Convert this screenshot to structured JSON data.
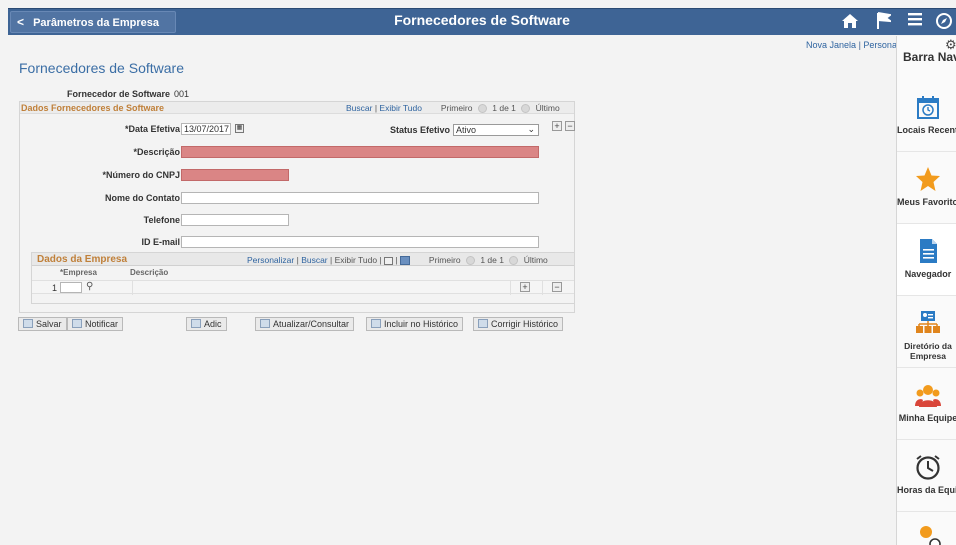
{
  "header": {
    "back_label": "Parâmetros da Empresa",
    "back_chevron": "<",
    "title": "Fornecedores de Software",
    "icons": [
      "home-icon",
      "flag-icon",
      "menu-icon",
      "compass-icon"
    ]
  },
  "links": {
    "new_window": "Nova Janela",
    "separator": "|",
    "personalize": "Personalizar"
  },
  "page_title": "Fornecedores de Software",
  "vendor": {
    "label": "Fornecedor de Software",
    "value": "001"
  },
  "group": {
    "title": "Dados Fornecedores de Software",
    "nav": {
      "find": "Buscar",
      "view_all": "Exibir Tudo",
      "first": "Primeiro",
      "counter": "1 de 1",
      "last": "Último"
    }
  },
  "fields": {
    "effdt_label": "*Data Efetiva",
    "effdt_value": "13/07/2017",
    "status_label": "Status Efetivo",
    "status_value": "Ativo",
    "descr_label": "*Descrição",
    "descr_value": "",
    "cnpj_label": "*Número do CNPJ",
    "cnpj_value": "",
    "contact_label": "Nome do Contato",
    "contact_value": "",
    "phone_label": "Telefone",
    "phone_value": "",
    "email_label": "ID E-mail",
    "email_value": ""
  },
  "subgrid": {
    "title": "Dados da Empresa",
    "nav": {
      "personalize": "Personalizar",
      "find": "Buscar",
      "view_all": "Exibir Tudo",
      "first": "Primeiro",
      "counter": "1 de 1",
      "last": "Último"
    },
    "columns": [
      "*Empresa",
      "Descrição"
    ],
    "rows": [
      {
        "num": "1",
        "empresa": "",
        "descricao": ""
      }
    ]
  },
  "buttons": {
    "save": "Salvar",
    "notify": "Notificar",
    "add": "Adic",
    "update": "Atualizar/Consultar",
    "include_history": "Incluir no Histórico",
    "correct_history": "Corrigir Histórico"
  },
  "navbar": {
    "title": "Barra Navegação",
    "items": [
      {
        "label": "Locais Recentes",
        "icon": "calendar-clock-icon"
      },
      {
        "label": "Meus Favoritos",
        "icon": "star-icon"
      },
      {
        "label": "Navegador",
        "icon": "document-icon"
      },
      {
        "label": "Diretório da Empresa",
        "icon": "org-chart-icon"
      },
      {
        "label": "Minha Equipe",
        "icon": "team-icon"
      },
      {
        "label": "Horas da Equipe",
        "icon": "clock-icon"
      }
    ]
  },
  "colors": {
    "header": "#3e6495",
    "required": "#da8585",
    "accent_label": "#c0803a",
    "link": "#2f64a0",
    "title": "#3b6ea5"
  }
}
